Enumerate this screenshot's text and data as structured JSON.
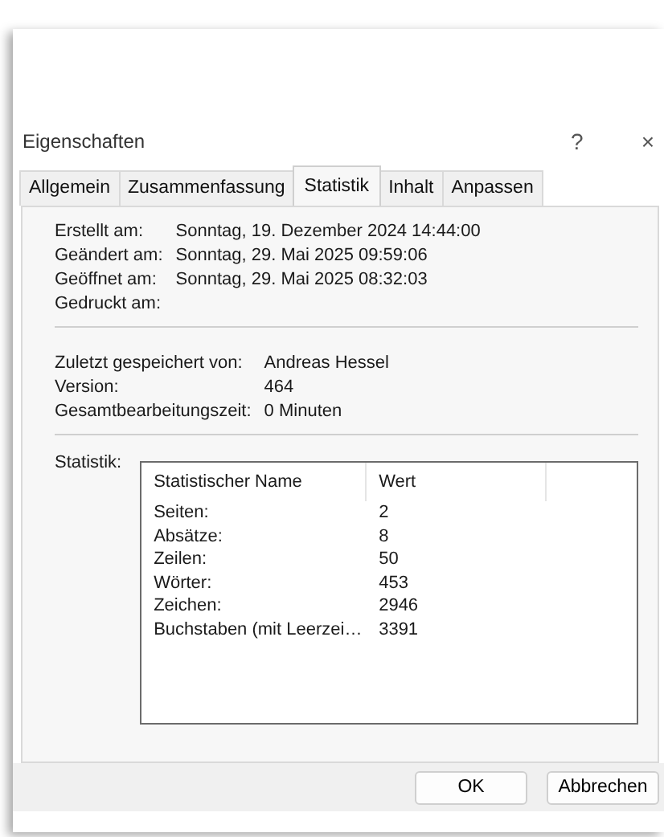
{
  "window": {
    "title": "Eigenschaften",
    "help": "?",
    "close": "×"
  },
  "tabs": [
    {
      "label": "Allgemein",
      "selected": false
    },
    {
      "label": "Zusammenfassung",
      "selected": false
    },
    {
      "label": "Statistik",
      "selected": true
    },
    {
      "label": "Inhalt",
      "selected": false
    },
    {
      "label": "Anpassen",
      "selected": false
    }
  ],
  "dates": [
    {
      "label": "Erstellt am:",
      "value": "Sonntag, 19. Dezember 2024 14:44:00"
    },
    {
      "label": "Geändert am:",
      "value": "Sonntag, 29. Mai 2025 09:59:06"
    },
    {
      "label": "Geöffnet am:",
      "value": "Sonntag, 29. Mai 2025 08:32:03"
    },
    {
      "label": "Gedruckt am:"
    }
  ],
  "info": [
    {
      "label": "Zuletzt gespeichert von:",
      "value": "Andreas Hessel"
    },
    {
      "label": "Version:",
      "value": "464"
    },
    {
      "label": "Gesamtbearbeitungszeit:",
      "value": "0 Minuten"
    }
  ],
  "statistics": {
    "label": "Statistik:",
    "columns": [
      "Statistischer Name",
      "Wert"
    ],
    "rows": [
      [
        "Seiten:",
        "2"
      ],
      [
        "Absätze:",
        "8"
      ],
      [
        "Zeilen:",
        "50"
      ],
      [
        "Wörter:",
        "453"
      ],
      [
        "Zeichen:",
        "2946"
      ],
      [
        "Buchstaben (mit Leerzei…",
        "3391"
      ]
    ]
  },
  "buttons": [
    "OK",
    "Abbrechen"
  ]
}
